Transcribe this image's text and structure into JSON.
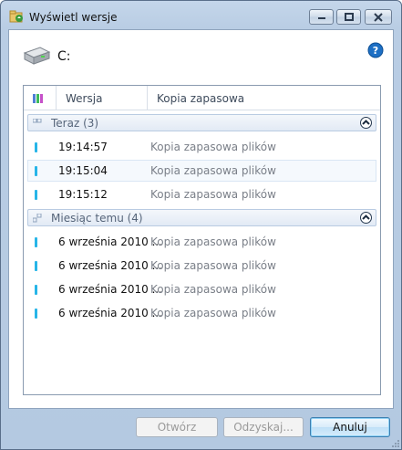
{
  "window": {
    "title": "Wyświetl wersje"
  },
  "drive": {
    "label": "C:"
  },
  "list": {
    "columns": {
      "version": "Wersja",
      "backup": "Kopia zapasowa"
    },
    "groups": [
      {
        "label": "Teraz (3)",
        "rows": [
          {
            "version": "19:14:57",
            "backup": "Kopia zapasowa plików"
          },
          {
            "version": "19:15:04",
            "backup": "Kopia zapasowa plików"
          },
          {
            "version": "19:15:12",
            "backup": "Kopia zapasowa plików"
          }
        ]
      },
      {
        "label": "Miesiąc temu (4)",
        "rows": [
          {
            "version": "6 września 2010 ...",
            "backup": "Kopia zapasowa plików"
          },
          {
            "version": "6 września 2010 ...",
            "backup": "Kopia zapasowa plików"
          },
          {
            "version": "6 września 2010 ...",
            "backup": "Kopia zapasowa plików"
          },
          {
            "version": "6 września 2010 ...",
            "backup": "Kopia zapasowa plików"
          }
        ]
      }
    ]
  },
  "buttons": {
    "open": "Otwórz",
    "recover": "Odzyskaj...",
    "cancel": "Anuluj"
  },
  "icons": {
    "title": "folder-versions-icon",
    "drive": "hard-drive-icon",
    "help": "help-icon",
    "column": "backup-type-icon",
    "group": "group-icon",
    "collapse": "collapse-icon",
    "row": "backup-marker-icon"
  },
  "colors": {
    "accent": "#27b5e8",
    "help": "#1d6fc4",
    "group_border": "#b9cbe2"
  }
}
